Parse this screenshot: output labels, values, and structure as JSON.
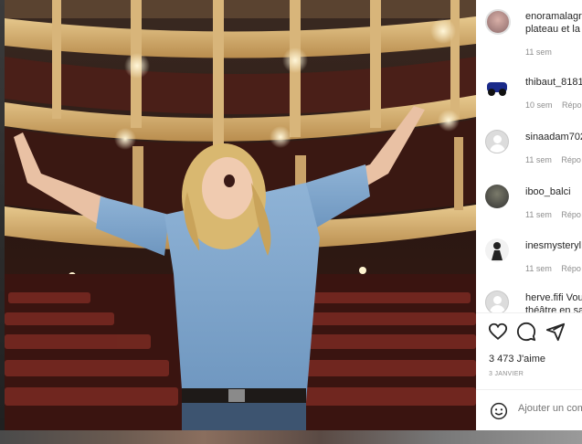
{
  "comments": [
    {
      "username": "enoramalagre",
      "text": "plateau et la",
      "time": "11 sem",
      "reply": ""
    },
    {
      "username": "thibaut_8181",
      "text": "",
      "time": "10 sem",
      "reply": "Répo"
    },
    {
      "username": "sinaadam702",
      "text": "",
      "time": "11 sem",
      "reply": "Répo"
    },
    {
      "username": "iboo_balci",
      "text": "",
      "time": "11 sem",
      "reply": "Répo"
    },
    {
      "username": "inesmysteryl",
      "text": "",
      "time": "11 sem",
      "reply": "Répo"
    },
    {
      "username": "herve.fifi",
      "text": "Vou",
      "time": "",
      "reply": ""
    }
  ],
  "comment_overflow": "théâtre en sa",
  "actions": {
    "like_icon": "heart-icon",
    "comment_icon": "comment-icon",
    "share_icon": "paper-plane-icon"
  },
  "likes": "3 473 J'aime",
  "date": "3 JANVIER",
  "composer": {
    "placeholder": "Ajouter un com",
    "emoji_icon": "smiley-icon"
  },
  "colors": {
    "text": "#262626",
    "muted": "#8e8e8e",
    "divider": "#efefef"
  }
}
